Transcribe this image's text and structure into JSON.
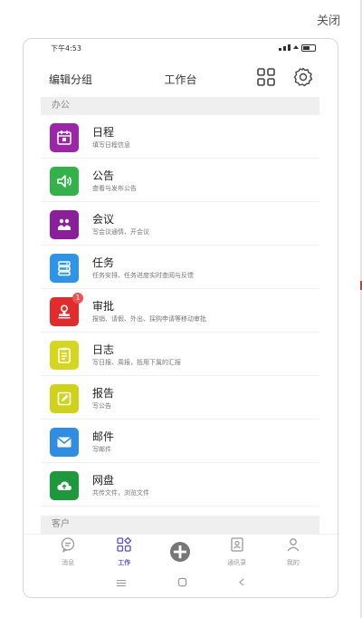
{
  "close_label": "关闭",
  "status_bar": {
    "time": "下午4:53"
  },
  "header": {
    "edit_group_label": "编辑分组",
    "title": "工作台"
  },
  "sections": [
    {
      "label": "办公"
    },
    {
      "label": "客户"
    }
  ],
  "apps": [
    {
      "title": "日程",
      "desc": "填写日程信息",
      "color": "#9b27a8",
      "icon": "calendar-icon"
    },
    {
      "title": "公告",
      "desc": "查看与发布公告",
      "color": "#34b24a",
      "icon": "speaker-icon"
    },
    {
      "title": "会议",
      "desc": "写会议通情、开会议",
      "color": "#8a1f9c",
      "icon": "meeting-icon"
    },
    {
      "title": "任务",
      "desc": "任务安排、任务进度实时查阅与反馈",
      "color": "#2c95e8",
      "icon": "task-icon"
    },
    {
      "title": "审批",
      "desc": "报销、请假、外出、採购申请等移动审批",
      "color": "#e22b2b",
      "icon": "stamp-icon",
      "badge": "1"
    },
    {
      "title": "日志",
      "desc": "写日报、周报，抵用下属的汇报",
      "color": "#d4d61f",
      "icon": "notebook-icon"
    },
    {
      "title": "报告",
      "desc": "写公告",
      "color": "#cfd21a",
      "icon": "edit-icon"
    },
    {
      "title": "邮件",
      "desc": "写邮件",
      "color": "#2f8ee4",
      "icon": "mail-icon"
    },
    {
      "title": "网盘",
      "desc": "共传文件，浏览文件",
      "color": "#1c9a3b",
      "icon": "cloud-icon"
    }
  ],
  "tabs": [
    {
      "label": "消息",
      "icon": "chat-icon"
    },
    {
      "label": "工作",
      "icon": "work-icon",
      "active": true
    },
    {
      "label": "",
      "icon": "plus-icon"
    },
    {
      "label": "通讯录",
      "icon": "contacts-icon"
    },
    {
      "label": "我的",
      "icon": "user-icon"
    }
  ],
  "colors": {
    "accent": "#5b4fd1",
    "section_bg": "#efefef"
  }
}
